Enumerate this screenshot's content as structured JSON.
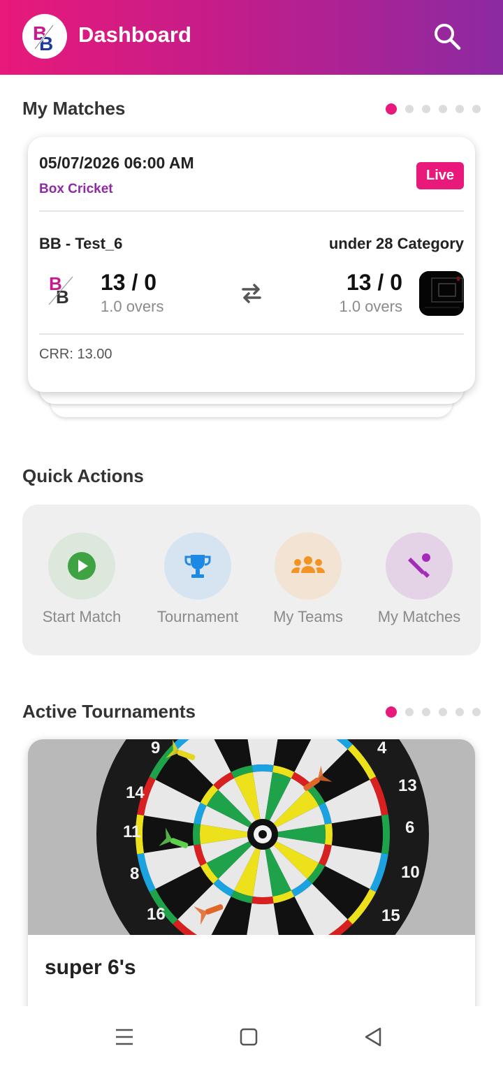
{
  "header": {
    "title": "Dashboard",
    "logo_text": "BB"
  },
  "my_matches": {
    "title": "My Matches",
    "match": {
      "datetime": "05/07/2026 06:00 AM",
      "match_type": "Box Cricket",
      "status": "Live",
      "team1": {
        "name": "BB - Test_6",
        "score": "13 / 0",
        "overs": "1.0 overs"
      },
      "team2": {
        "name": "under 28 Category",
        "score": "13 / 0",
        "overs": "1.0 overs"
      },
      "crr": "CRR: 13.00"
    }
  },
  "quick_actions": {
    "title": "Quick Actions",
    "items": [
      {
        "label": "Start Match",
        "icon": "play-icon",
        "color": "#3fa344",
        "bg": "#dde8dd"
      },
      {
        "label": "Tournament",
        "icon": "trophy-icon",
        "color": "#1e88e5",
        "bg": "#d6e4f2"
      },
      {
        "label": "My Teams",
        "icon": "group-icon",
        "color": "#f39325",
        "bg": "#f3e3d2"
      },
      {
        "label": "My Matches",
        "icon": "cricket-icon",
        "color": "#a42ab8",
        "bg": "#e4d2e7"
      }
    ]
  },
  "active_tournaments": {
    "title": "Active Tournaments",
    "tournament": {
      "name": "super 6's",
      "board_numbers": [
        "9",
        "4",
        "14",
        "13",
        "11",
        "6",
        "8",
        "10",
        "16",
        "15"
      ]
    }
  },
  "colors": {
    "accent": "#e8197a",
    "purple": "#8e2aa4"
  }
}
